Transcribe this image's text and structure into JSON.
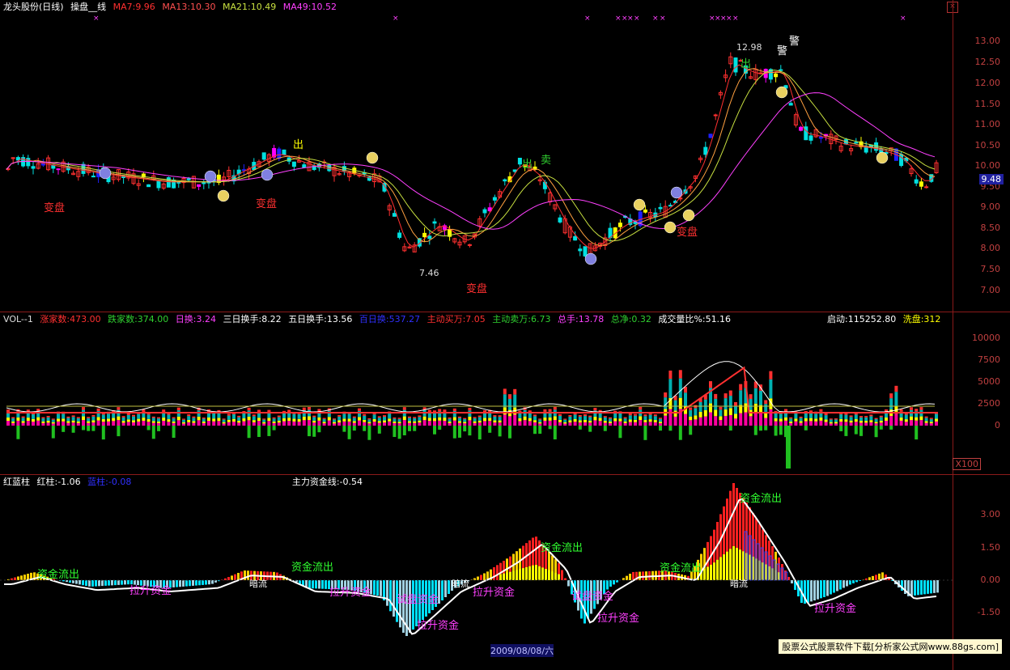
{
  "kline": {
    "title": "龙头股份(日线)",
    "indicator": "操盘__线",
    "ma": [
      {
        "label": "MA7:9.96",
        "color": "#ff3030"
      },
      {
        "label": "MA13:10.30",
        "color": "#ff5050"
      },
      {
        "label": "MA21:10.49",
        "color": "#c8e040"
      },
      {
        "label": "MA49:10.52",
        "color": "#ff40ff"
      }
    ],
    "y_ticks": [
      "13.00",
      "12.50",
      "12.00",
      "11.50",
      "11.00",
      "10.50",
      "10.00",
      "9.50",
      "9.00",
      "8.50",
      "8.00",
      "7.50",
      "7.00"
    ],
    "price_tag": "9.48",
    "labels": {
      "bianpan": "变盘",
      "chu": "出",
      "mai": "卖",
      "jing": "警",
      "high": "12.98",
      "low": "7.46"
    }
  },
  "volume": {
    "items": [
      {
        "label": "VOL--1",
        "color": "#dddddd"
      },
      {
        "label": "涨家数:473.00",
        "color": "#ff3030"
      },
      {
        "label": "跌家数:374.00",
        "color": "#30d030"
      },
      {
        "label": "日换:3.24",
        "color": "#ff40ff"
      },
      {
        "label": "三日换手:8.22",
        "color": "#ffffff"
      },
      {
        "label": "五日换手:13.56",
        "color": "#ffffff"
      },
      {
        "label": "百日换:537.27",
        "color": "#3030ff"
      },
      {
        "label": "主动买万:7.05",
        "color": "#ff3030"
      },
      {
        "label": "主动卖万:6.73",
        "color": "#30d030"
      },
      {
        "label": "总手:13.78",
        "color": "#ff40ff"
      },
      {
        "label": "总净:0.32",
        "color": "#30d030"
      },
      {
        "label": "成交量比%:51.16",
        "color": "#ffffff"
      }
    ],
    "right_items": [
      {
        "label": "启动:115252.80",
        "color": "#ffffff"
      },
      {
        "label": "洗盘:312",
        "color": "#ffff00"
      }
    ],
    "y_ticks": [
      "10000",
      "7500",
      "5000",
      "2500",
      "0"
    ],
    "unit": "X100"
  },
  "fund": {
    "items": [
      {
        "label": "红蓝柱",
        "color": "#ffffff"
      },
      {
        "label": "红柱:-1.06",
        "color": "#ffffff"
      },
      {
        "label": "蓝柱:-0.08",
        "color": "#3030ff"
      },
      {
        "label": "主力资金线:-0.54",
        "color": "#ffffff"
      }
    ],
    "y_ticks": [
      "3.00",
      "1.50",
      "0.00",
      "-1.50"
    ],
    "labels": {
      "outflow": "资金流出",
      "lift": "拉升资金",
      "trial": "试盘资金",
      "dark": "暗流"
    }
  },
  "bottom": {
    "date": "2009/08/08/六",
    "watermark": "股票公式股票软件下载[分析家公式网www.88gs.com]"
  },
  "close_icon": "close-icon"
}
